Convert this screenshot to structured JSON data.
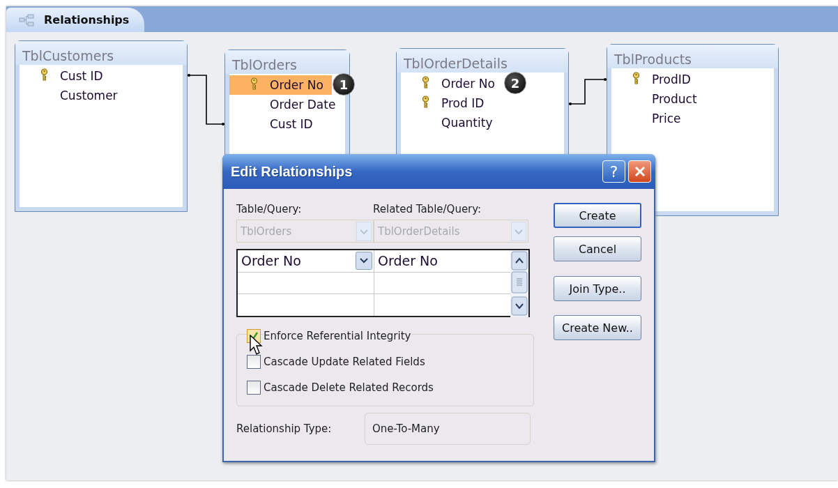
{
  "tab": {
    "label": "Relationships",
    "selected": true
  },
  "tables": [
    {
      "title": "TblCustomers",
      "fields": [
        {
          "name": "Cust ID",
          "key": true,
          "selected": false
        },
        {
          "name": "Customer",
          "key": false,
          "selected": false
        }
      ]
    },
    {
      "title": "TblOrders",
      "fields": [
        {
          "name": "Order No",
          "key": true,
          "selected": true,
          "badge": "1"
        },
        {
          "name": "Order Date",
          "key": false,
          "selected": false
        },
        {
          "name": "Cust ID",
          "key": false,
          "selected": false
        }
      ]
    },
    {
      "title": "TblOrderDetails",
      "fields": [
        {
          "name": "Order No",
          "key": true,
          "selected": false,
          "badge": "2"
        },
        {
          "name": "Prod ID",
          "key": true,
          "selected": false
        },
        {
          "name": "Quantity",
          "key": false,
          "selected": false
        }
      ]
    },
    {
      "title": "TblProducts",
      "fields": [
        {
          "name": "ProdID",
          "key": true,
          "selected": false
        },
        {
          "name": "Product",
          "key": false,
          "selected": false
        },
        {
          "name": "Price",
          "key": false,
          "selected": false
        }
      ]
    }
  ],
  "dialog": {
    "title": "Edit Relationships",
    "help": "?",
    "table_label": "Table/Query:",
    "related_label": "Related Table/Query:",
    "table_value": "TblOrders",
    "related_value": "TblOrderDetails",
    "grid": [
      {
        "table_field": "Order No",
        "related_field": "Order No"
      }
    ],
    "options": [
      {
        "label": "Enforce Referential Integrity",
        "checked": true
      },
      {
        "label": "Cascade Update Related Fields",
        "checked": false
      },
      {
        "label": "Cascade Delete Related Records",
        "checked": false
      }
    ],
    "type_label": "Relationship Type:",
    "type_value": "One-To-Many",
    "buttons": [
      {
        "label": "Create",
        "default": true
      },
      {
        "label": "Cancel",
        "default": false
      },
      {
        "label": "Join Type..",
        "default": false
      },
      {
        "label": "Create New..",
        "default": false
      }
    ]
  }
}
